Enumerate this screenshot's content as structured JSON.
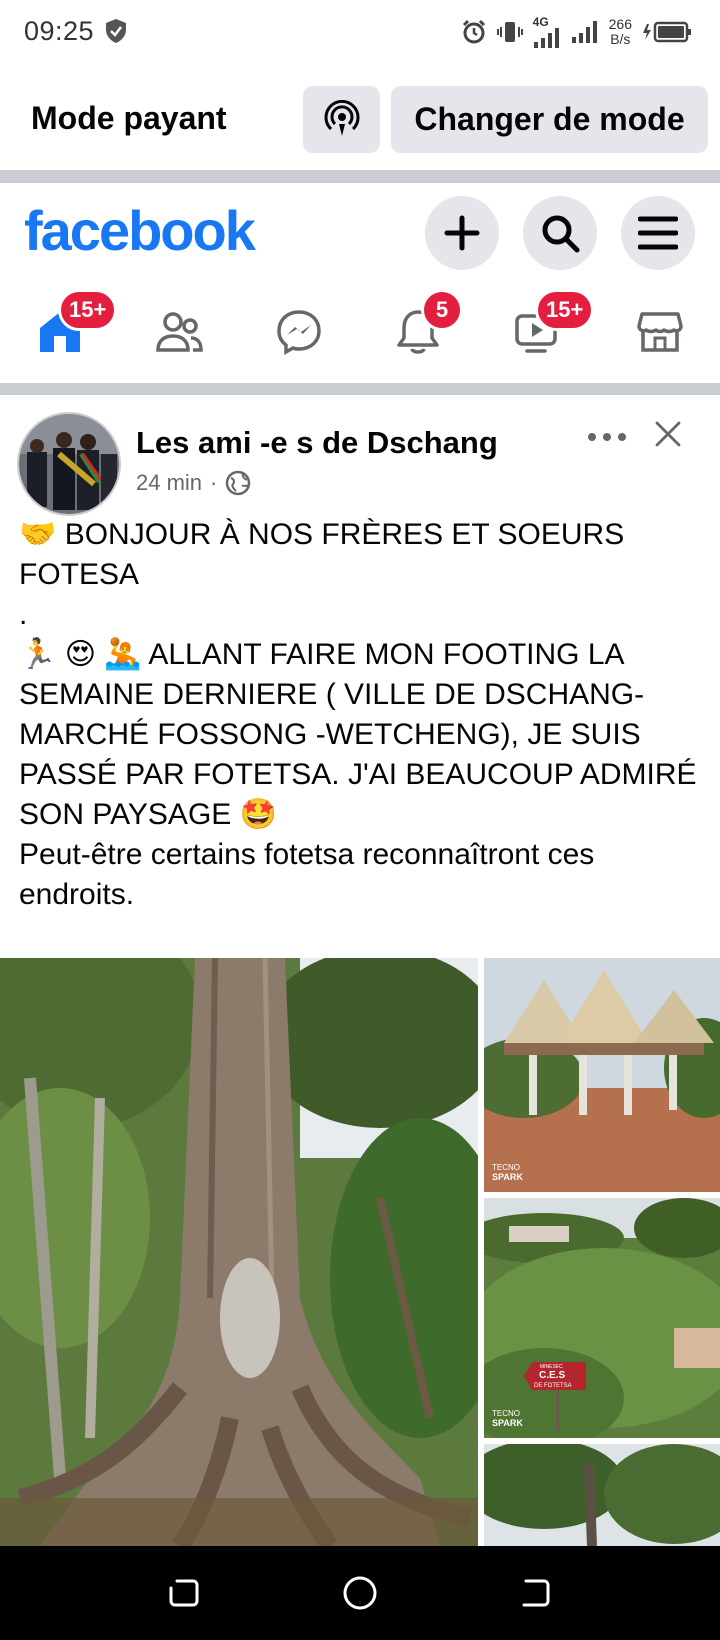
{
  "status_bar": {
    "time": "09:25",
    "network": "4G",
    "speed_value": "266",
    "speed_unit": "B/s"
  },
  "mode_bar": {
    "title": "Mode payant",
    "change_button": "Changer de mode"
  },
  "header": {
    "logo": "facebook",
    "brand_color": "#1877f2"
  },
  "nav": {
    "items": [
      {
        "name": "home",
        "badge": "15+",
        "active": true
      },
      {
        "name": "friends",
        "badge": ""
      },
      {
        "name": "messenger",
        "badge": ""
      },
      {
        "name": "notifications",
        "badge": "5"
      },
      {
        "name": "video",
        "badge": "15+"
      },
      {
        "name": "marketplace",
        "badge": ""
      }
    ]
  },
  "post": {
    "author": "Les ami -e s de Dschang",
    "time": "24 min",
    "time_separator": "·",
    "line1": "🤝 BONJOUR À NOS FRÈRES ET SOEURS FOTESA",
    "line2": ".",
    "line3": "🏃 😍 🤽 ALLANT FAIRE MON FOOTING LA SEMAINE DERNIERE ( VILLE DE DSCHANG-MARCHÉ FOSSONG -WETCHENG), JE SUIS PASSÉ PAR FOTETSA. J'AI BEAUCOUP ADMIRÉ SON PAYSAGE 🤩",
    "line4": "Peut-être certains fotetsa reconnaîtront ces endroits.",
    "photo_watermark_1": "TECNO",
    "photo_watermark_2": "SPARK",
    "sign_small": "MINESEC",
    "sign_large": "C.E.S",
    "sign_sub": "DE FOTETSA"
  }
}
